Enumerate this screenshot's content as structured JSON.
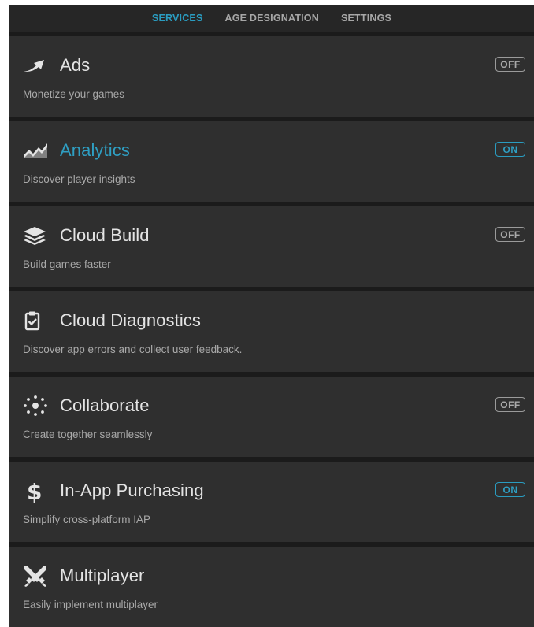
{
  "tabs": [
    {
      "label": "SERVICES",
      "active": true
    },
    {
      "label": "AGE DESIGNATION",
      "active": false
    },
    {
      "label": "SETTINGS",
      "active": false
    }
  ],
  "services": [
    {
      "title": "Ads",
      "description": "Monetize your games",
      "toggle": "OFF",
      "icon": "ads-arrow-icon"
    },
    {
      "title": "Analytics",
      "description": "Discover player insights",
      "toggle": "ON",
      "icon": "analytics-chart-icon"
    },
    {
      "title": "Cloud Build",
      "description": "Build games faster",
      "toggle": "OFF",
      "icon": "cloud-build-layers-icon"
    },
    {
      "title": "Cloud Diagnostics",
      "description": "Discover app errors and collect user feedback.",
      "toggle": "",
      "icon": "clipboard-check-icon"
    },
    {
      "title": "Collaborate",
      "description": "Create together seamlessly",
      "toggle": "OFF",
      "icon": "collaborate-network-icon"
    },
    {
      "title": "In-App Purchasing",
      "description": "Simplify cross-platform IAP",
      "toggle": "ON",
      "icon": "dollar-icon"
    },
    {
      "title": "Multiplayer",
      "description": "Easily implement multiplayer",
      "toggle": "",
      "icon": "multiplayer-swords-icon"
    }
  ],
  "colors": {
    "accent": "#2a9cc0",
    "card_bg": "#2f2f2f",
    "separator": "#1b1b1b",
    "text_primary": "#e4e4e4",
    "text_secondary": "#a9a9a9"
  }
}
